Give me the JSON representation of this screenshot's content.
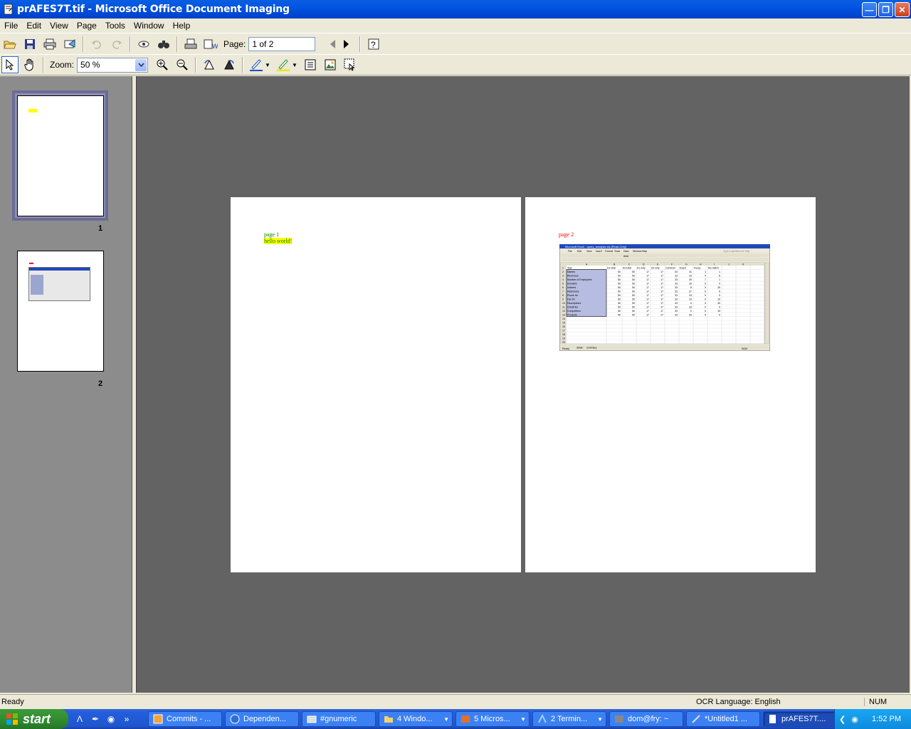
{
  "window": {
    "title": "prAFES7T.tif - Microsoft Office Document Imaging",
    "buttons": [
      "minimize",
      "restore",
      "close"
    ]
  },
  "menu": [
    "File",
    "Edit",
    "View",
    "Page",
    "Tools",
    "Window",
    "Help"
  ],
  "toolbar1": {
    "page_label": "Page:",
    "page_value": "1 of 2"
  },
  "toolbar2": {
    "zoom_label": "Zoom:",
    "zoom_value": "50 %"
  },
  "thumbnails": [
    {
      "label": "1",
      "selected": true
    },
    {
      "label": "2",
      "selected": false
    }
  ],
  "pages": {
    "page1": {
      "line1": "page 1",
      "line2": "hello world!",
      "highlight_color": "#ffff00",
      "text_color": "#008000"
    },
    "page2": {
      "heading": "page 2",
      "heading_color": "#ff0000",
      "embedded_excel": {
        "title": "Microsoft Excel - query_analysis.xls [Read-Only]",
        "menu": [
          "File",
          "Edit",
          "View",
          "Insert",
          "Format",
          "Tools",
          "Data",
          "Window",
          "Help"
        ],
        "help_box": "Type a question for help",
        "font_box": "Arial",
        "columns": [
          "A",
          "B",
          "C",
          "D",
          "E",
          "F",
          "G",
          "H",
          "I",
          "J",
          "K"
        ],
        "headers": [
          "Test",
          "S1 total",
          "S2 total",
          "S1 only",
          "S2 only",
          "Common",
          "Exact",
          "Fuzzy",
          "No match"
        ],
        "rows": [
          [
            "Names",
            "50",
            "50",
            "17",
            "17",
            "33",
            "31",
            "1",
            "1"
          ],
          [
            "Revenues",
            "50",
            "50",
            "17",
            "17",
            "33",
            "23",
            "4",
            "6"
          ],
          [
            "Number of Employees",
            "50",
            "50",
            "17",
            "17",
            "33",
            "25",
            "7",
            "1"
          ],
          [
            "Domains",
            "50",
            "50",
            "17",
            "17",
            "33",
            "33",
            "0",
            "0"
          ],
          [
            "Indexes",
            "50",
            "50",
            "17",
            "17",
            "33",
            "8",
            "0",
            "25"
          ],
          [
            "Addresses",
            "50",
            "50",
            "17",
            "17",
            "33",
            "27",
            "0",
            "6"
          ],
          [
            "Phone #s",
            "50",
            "50",
            "17",
            "17",
            "33",
            "24",
            "0",
            "9"
          ],
          [
            "Fax #s",
            "50",
            "50",
            "17",
            "17",
            "33",
            "23",
            "0",
            "10"
          ],
          [
            "Descriptions",
            "50",
            "50",
            "17",
            "17",
            "33",
            "0",
            "3",
            "30"
          ],
          [
            "Industries",
            "50",
            "50",
            "17",
            "17",
            "33",
            "33",
            "0",
            "0"
          ],
          [
            "Competitors",
            "50",
            "50",
            "17",
            "17",
            "33",
            "0",
            "0",
            "33"
          ],
          [
            "Products",
            "50",
            "50",
            "17",
            "17",
            "33",
            "33",
            "0",
            "0"
          ]
        ],
        "sheet_tabs": [
          "detail",
          "summary"
        ],
        "status_left": "Ready",
        "status_right": "NUM"
      }
    }
  },
  "status": {
    "left": "Ready",
    "ocr": "OCR Language: English",
    "num": "NUM"
  },
  "taskbar": {
    "start": "start",
    "tasks": [
      {
        "label": "Commits - ...",
        "active": false
      },
      {
        "label": "Dependen...",
        "active": false
      },
      {
        "label": "#gnumeric",
        "active": false
      },
      {
        "label": "4 Windo...",
        "active": false,
        "group": true
      },
      {
        "label": "5 Micros...",
        "active": false,
        "group": true
      },
      {
        "label": "2 Termin...",
        "active": false,
        "group": true
      },
      {
        "label": "dom@fry: ~",
        "active": false
      },
      {
        "label": "*Untitled1 ...",
        "active": false
      },
      {
        "label": "prAFES7T....",
        "active": true
      }
    ],
    "clock": "1:52 PM"
  }
}
